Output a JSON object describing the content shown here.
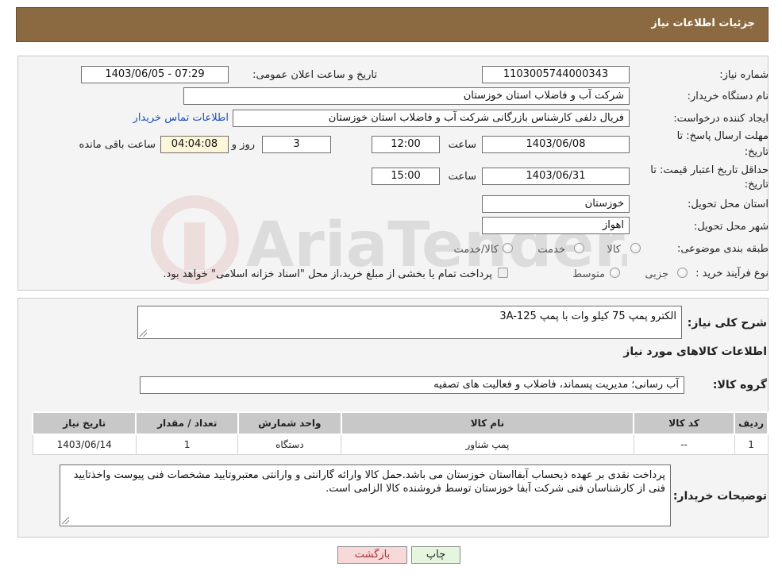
{
  "header": {
    "title": "جزئیات اطلاعات نیاز"
  },
  "form": {
    "need_number_label": "شماره نیاز:",
    "need_number": "1103005744000343",
    "announce_label": "تاریخ و ساعت اعلان عمومی:",
    "announce_value": "1403/06/05 - 07:29",
    "buyer_org_label": "نام دستگاه خریدار:",
    "buyer_org": "شرکت آب و فاضلاب استان خوزستان",
    "creator_label": "ایجاد کننده درخواست:",
    "creator": "فریال دلفی کارشناس بازرگانی شرکت آب و فاضلاب استان خوزستان",
    "contact_link": "اطلاعات تماس خریدار",
    "deadline_label_1": "مهلت ارسال پاسخ: تا",
    "deadline_label_2": "تاریخ:",
    "deadline_date": "1403/06/08",
    "time_label": "ساعت",
    "deadline_time": "12:00",
    "days_value": "3",
    "days_label": "روز و",
    "remaining_value": "04:04:08",
    "remaining_label": "ساعت باقی مانده",
    "validity_label_1": "حداقل تاریخ اعتبار قیمت: تا",
    "validity_label_2": "تاریخ:",
    "validity_date": "1403/06/31",
    "validity_time": "15:00",
    "province_label": "استان محل تحویل:",
    "province": "خوزستان",
    "city_label": "شهر محل تحویل:",
    "city": "اهواز",
    "category_label": "طبقه بندی موضوعی:",
    "category_options": [
      "کالا",
      "خدمت",
      "کالا/خدمت"
    ],
    "process_label": "نوع فرآیند خرید :",
    "process_options": [
      "جزیی",
      "متوسط"
    ],
    "process_note": "پرداخت تمام یا بخشی از مبلغ خرید،از محل \"اسناد خزانه اسلامی\" خواهد بود."
  },
  "summary": {
    "label": "شرح کلی نیاز:",
    "text": "الکترو پمپ 75 کیلو وات با پمپ 3A-125",
    "items_heading": "اطلاعات کالاهای مورد نیاز",
    "group_label": "گروه کالا:",
    "group_value": "آب رسانی؛ مدیریت پسماند، فاضلاب و فعالیت های تصفیه"
  },
  "table": {
    "headers": [
      "ردیف",
      "کد کالا",
      "نام کالا",
      "واحد شمارش",
      "تعداد / مقدار",
      "تاریخ نیاز"
    ],
    "rows": [
      [
        "1",
        "--",
        "پمپ شناور",
        "دستگاه",
        "1",
        "1403/06/14"
      ]
    ]
  },
  "notes": {
    "label": "توضیحات خریدار:",
    "text": "پرداخت نقدی بر عهده ذیحساب آبفااستان خوزستان می باشد.حمل کالا وارائه گارانتی و وارانتی معتبروتایید مشخصات فنی پیوست واخذتایید فنی از کارشناسان فنی شرکت آبفا خوزستان توسط فروشنده کالا الزامی است."
  },
  "buttons": {
    "print": "چاپ",
    "back": "بازگشت"
  },
  "watermark": {
    "text": "AriaTender.neT"
  },
  "colors": {
    "header_bg": "#8b6a42",
    "back_btn_bg": "#f7d9d9",
    "print_btn_bg": "#e5f5de",
    "link": "#1a4fb5"
  }
}
